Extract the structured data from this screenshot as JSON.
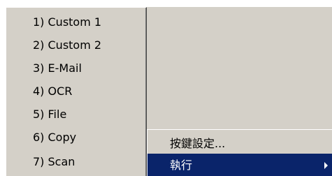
{
  "submenu": {
    "items": [
      {
        "label": "1) Custom 1"
      },
      {
        "label": "2) Custom 2"
      },
      {
        "label": "3) E-Mail"
      },
      {
        "label": "4) OCR"
      },
      {
        "label": "5) File"
      },
      {
        "label": "6) Copy"
      },
      {
        "label": "7) Scan"
      }
    ]
  },
  "menu": {
    "items": [
      {
        "label": "按鍵設定..."
      },
      {
        "label": "執行",
        "selected": true,
        "icon": "chevron-right-icon"
      }
    ]
  },
  "colors": {
    "menu_bg": "#d4d0c8",
    "selection_bg": "#0a246a",
    "selection_text": "#ffffff"
  }
}
